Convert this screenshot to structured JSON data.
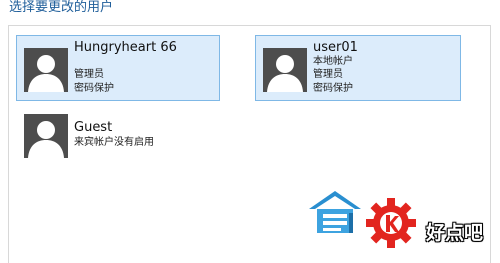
{
  "header": {
    "title": "选择要更改的用户"
  },
  "accounts": [
    {
      "name": "Hungryheart 66",
      "details": [
        "管理员",
        "密码保护"
      ],
      "selected": true
    },
    {
      "name": "user01",
      "details": [
        "本地帐户",
        "管理员",
        "密码保护"
      ],
      "selected": true
    },
    {
      "name": "Guest",
      "details": [
        "来宾帐户没有启用"
      ],
      "selected": false
    }
  ],
  "watermark": {
    "text": "好点吧"
  },
  "colors": {
    "heading": "#1f5e9a",
    "tile_selected_bg": "#dcecfb",
    "tile_selected_border": "#7fb8e6",
    "avatar_bg": "#4d4d4d",
    "watermark_red": "#e2251f",
    "watermark_blue": "#2a8fd0"
  },
  "icons": {
    "avatar": "user-silhouette-icon",
    "watermark_house": "house-logo-icon",
    "watermark_gear": "gear-logo-icon"
  }
}
